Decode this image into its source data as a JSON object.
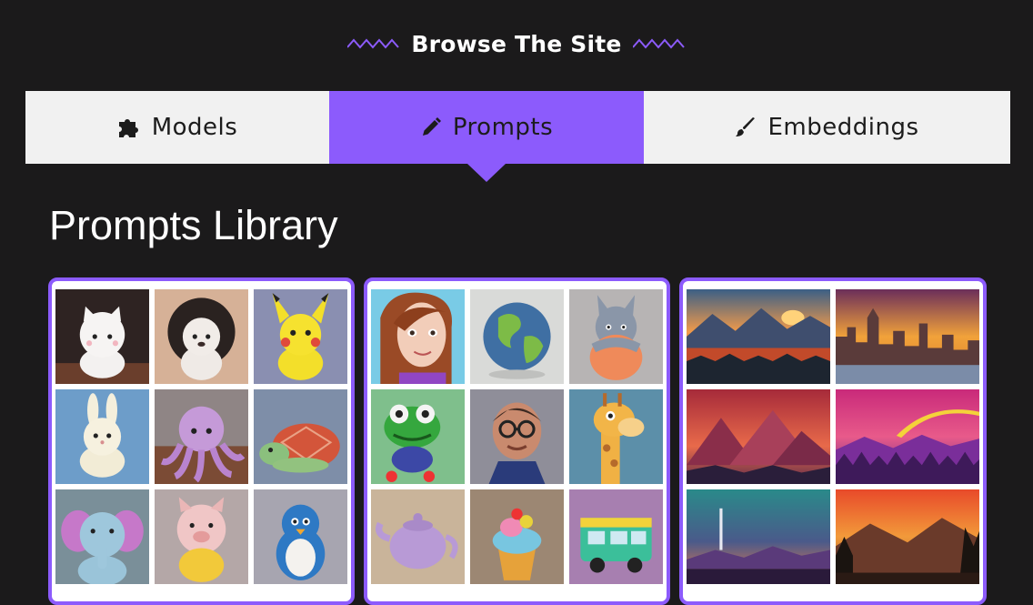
{
  "header": {
    "title": "Browse The Site"
  },
  "tabs": [
    {
      "label": "Models",
      "icon": "puzzle-icon",
      "active": false
    },
    {
      "label": "Prompts",
      "icon": "pencil-icon",
      "active": true
    },
    {
      "label": "Embeddings",
      "icon": "brush-icon",
      "active": false
    }
  ],
  "library": {
    "title": "Prompts Library"
  },
  "colors": {
    "accent": "#8c5bfc",
    "background": "#1b1a1b",
    "tab_bg": "#f1f1f1"
  },
  "cards": [
    {
      "theme": "felt-plush-animals",
      "images": [
        "kitten-plush-image",
        "hedgehog-plush-image",
        "pikachu-plush-image",
        "bunny-plush-image",
        "octopus-plush-image",
        "turtle-plush-image",
        "elephant-plush-image",
        "pig-plush-image",
        "penguin-plush-image"
      ]
    },
    {
      "theme": "felt-objects-characters",
      "images": [
        "felt-girl-portrait-image",
        "felt-globe-image",
        "totoro-plush-image",
        "frog-plush-image",
        "felt-man-glasses-image",
        "giraffe-plush-image",
        "felt-teapot-image",
        "felt-cupcake-image",
        "felt-van-image"
      ]
    },
    {
      "theme": "sunset-landscapes",
      "images": [
        "mountain-sunset-image",
        "city-skyline-sunset-image",
        "pyramid-mountains-image",
        "purple-forest-rainbow-image",
        "space-launch-sunset-image",
        "forest-deer-sunset-image"
      ]
    }
  ]
}
